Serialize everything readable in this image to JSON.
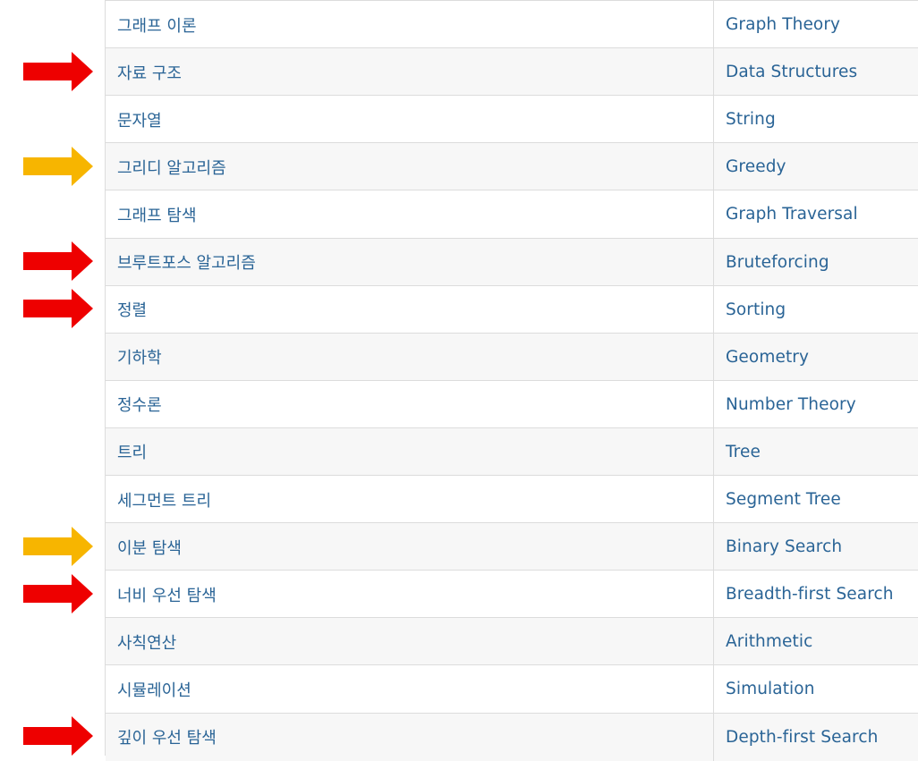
{
  "rows": [
    {
      "ko": "그래프 이론",
      "en": "Graph Theory",
      "arrow": null
    },
    {
      "ko": "자료 구조",
      "en": "Data Structures",
      "arrow": "red"
    },
    {
      "ko": "문자열",
      "en": "String",
      "arrow": null
    },
    {
      "ko": "그리디 알고리즘",
      "en": "Greedy",
      "arrow": "yellow"
    },
    {
      "ko": "그래프 탐색",
      "en": "Graph Traversal",
      "arrow": null
    },
    {
      "ko": "브루트포스 알고리즘",
      "en": "Bruteforcing",
      "arrow": "red"
    },
    {
      "ko": "정렬",
      "en": "Sorting",
      "arrow": "red"
    },
    {
      "ko": "기하학",
      "en": "Geometry",
      "arrow": null
    },
    {
      "ko": "정수론",
      "en": "Number Theory",
      "arrow": null
    },
    {
      "ko": "트리",
      "en": "Tree",
      "arrow": null
    },
    {
      "ko": "세그먼트 트리",
      "en": "Segment Tree",
      "arrow": null
    },
    {
      "ko": "이분 탐색",
      "en": "Binary Search",
      "arrow": "yellow"
    },
    {
      "ko": "너비 우선 탐색",
      "en": "Breadth-first Search",
      "arrow": "red"
    },
    {
      "ko": "사칙연산",
      "en": "Arithmetic",
      "arrow": null
    },
    {
      "ko": "시뮬레이션",
      "en": "Simulation",
      "arrow": null
    },
    {
      "ko": "깊이 우선 탐색",
      "en": "Depth-first Search",
      "arrow": "red"
    }
  ],
  "colors": {
    "link": "#2a6496",
    "arrow_red": "#ee0000",
    "arrow_yellow": "#f7b500",
    "border": "#dcdcdc"
  }
}
